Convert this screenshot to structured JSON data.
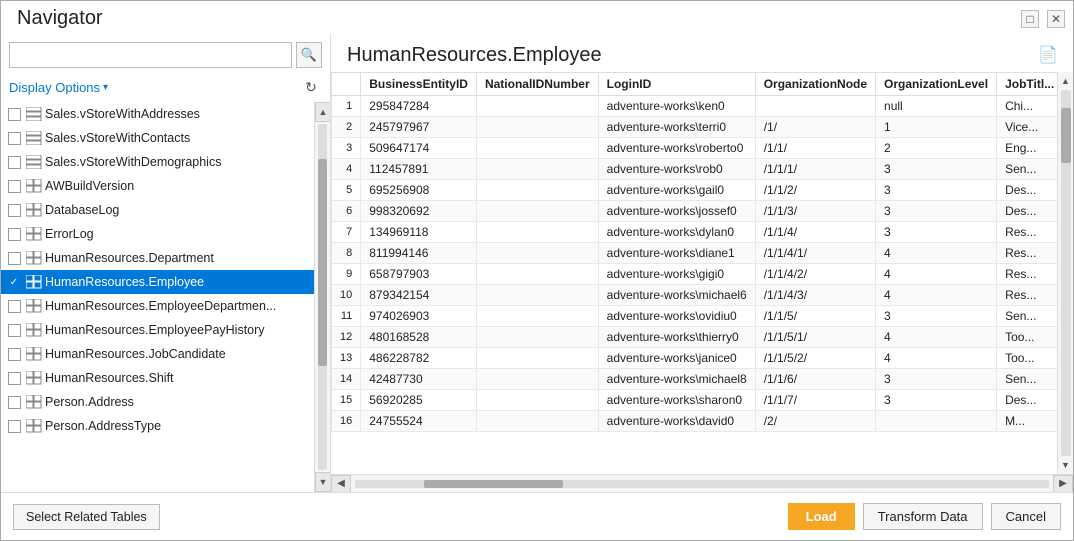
{
  "window": {
    "title": "Navigator"
  },
  "search": {
    "placeholder": "",
    "value": ""
  },
  "display_options": {
    "label": "Display Options",
    "arrow": "▾"
  },
  "nav_items": [
    {
      "id": "salesstorewithaddresses",
      "label": "Sales.vStoreWithAddresses",
      "checked": false,
      "type": "view",
      "selected": false
    },
    {
      "id": "salesstorewithcontacts",
      "label": "Sales.vStoreWithContacts",
      "checked": false,
      "type": "view",
      "selected": false
    },
    {
      "id": "salesstorewithdemographics",
      "label": "Sales.vStoreWithDemographics",
      "checked": false,
      "type": "view",
      "selected": false
    },
    {
      "id": "awbuildversion",
      "label": "AWBuildVersion",
      "checked": false,
      "type": "table",
      "selected": false
    },
    {
      "id": "databaselog",
      "label": "DatabaseLog",
      "checked": false,
      "type": "table",
      "selected": false
    },
    {
      "id": "errorlog",
      "label": "ErrorLog",
      "checked": false,
      "type": "table",
      "selected": false
    },
    {
      "id": "hrdepartment",
      "label": "HumanResources.Department",
      "checked": false,
      "type": "table",
      "selected": false
    },
    {
      "id": "hremployee",
      "label": "HumanResources.Employee",
      "checked": true,
      "type": "table",
      "selected": true
    },
    {
      "id": "hremployeedepartment",
      "label": "HumanResources.EmployeeDepartmen...",
      "checked": false,
      "type": "table",
      "selected": false
    },
    {
      "id": "hremployeepayhistory",
      "label": "HumanResources.EmployeePayHistory",
      "checked": false,
      "type": "table",
      "selected": false
    },
    {
      "id": "hrjobcandidate",
      "label": "HumanResources.JobCandidate",
      "checked": false,
      "type": "table",
      "selected": false
    },
    {
      "id": "hrshift",
      "label": "HumanResources.Shift",
      "checked": false,
      "type": "table",
      "selected": false
    },
    {
      "id": "personaddress",
      "label": "Person.Address",
      "checked": false,
      "type": "table",
      "selected": false
    },
    {
      "id": "personaddresstype",
      "label": "Person.AddressType",
      "checked": false,
      "type": "table",
      "selected": false
    }
  ],
  "preview": {
    "title": "HumanResources.Employee",
    "columns": [
      "BusinessEntityID",
      "NationalIDNumber",
      "LoginID",
      "OrganizationNode",
      "OrganizationLevel",
      "JobTitl..."
    ],
    "rows": [
      {
        "row": 1,
        "BusinessEntityID": "295847284",
        "NationalIDNumber": "",
        "LoginID": "adventure-works\\ken0",
        "OrganizationNode": "",
        "OrganizationLevel": "null",
        "JobTitle": "Chi..."
      },
      {
        "row": 1,
        "col1": "295847284",
        "col2": "",
        "col3": "adventure-works\\ken0",
        "col4": "",
        "col5": "null",
        "col6": "Chi..."
      },
      {
        "row": 2,
        "col1": "245797967",
        "col2": "",
        "col3": "adventure-works\\terri0",
        "col4": "/1/",
        "col5": "1",
        "col6": "Vice..."
      },
      {
        "row": 3,
        "col1": "509647174",
        "col2": "",
        "col3": "adventure-works\\roberto0",
        "col4": "/1/1/",
        "col5": "2",
        "col6": "Eng..."
      },
      {
        "row": 4,
        "col1": "112457891",
        "col2": "",
        "col3": "adventure-works\\rob0",
        "col4": "/1/1/1/",
        "col5": "3",
        "col6": "Sen..."
      },
      {
        "row": 5,
        "col1": "695256908",
        "col2": "",
        "col3": "adventure-works\\gail0",
        "col4": "/1/1/2/",
        "col5": "3",
        "col6": "Des..."
      },
      {
        "row": 6,
        "col1": "998320692",
        "col2": "",
        "col3": "adventure-works\\jossef0",
        "col4": "/1/1/3/",
        "col5": "3",
        "col6": "Des..."
      },
      {
        "row": 7,
        "col1": "134969118",
        "col2": "",
        "col3": "adventure-works\\dylan0",
        "col4": "/1/1/4/",
        "col5": "3",
        "col6": "Res..."
      },
      {
        "row": 8,
        "col1": "811994146",
        "col2": "",
        "col3": "adventure-works\\diane1",
        "col4": "/1/1/4/1/",
        "col5": "4",
        "col6": "Res..."
      },
      {
        "row": 9,
        "col1": "658797903",
        "col2": "",
        "col3": "adventure-works\\gigi0",
        "col4": "/1/1/4/2/",
        "col5": "4",
        "col6": "Res..."
      },
      {
        "row": 10,
        "col1": "879342154",
        "col2": "",
        "col3": "adventure-works\\michael6",
        "col4": "/1/1/4/3/",
        "col5": "4",
        "col6": "Res..."
      },
      {
        "row": 11,
        "col1": "974026903",
        "col2": "",
        "col3": "adventure-works\\ovidiu0",
        "col4": "/1/1/5/",
        "col5": "3",
        "col6": "Sen..."
      },
      {
        "row": 12,
        "col1": "480168528",
        "col2": "",
        "col3": "adventure-works\\thierry0",
        "col4": "/1/1/5/1/",
        "col5": "4",
        "col6": "Too..."
      },
      {
        "row": 13,
        "col1": "486228782",
        "col2": "",
        "col3": "adventure-works\\janice0",
        "col4": "/1/1/5/2/",
        "col5": "4",
        "col6": "Too..."
      },
      {
        "row": 14,
        "col1": "42487730",
        "col2": "",
        "col3": "adventure-works\\michael8",
        "col4": "/1/1/6/",
        "col5": "3",
        "col6": "Sen..."
      },
      {
        "row": 15,
        "col1": "56920285",
        "col2": "",
        "col3": "adventure-works\\sharon0",
        "col4": "/1/1/7/",
        "col5": "3",
        "col6": "Des..."
      },
      {
        "row": 16,
        "col1": "24755524",
        "col2": "",
        "col3": "adventure-works\\david0",
        "col4": "/2/",
        "col5": "",
        "col6": "M..."
      }
    ]
  },
  "footer": {
    "select_related": "Select Related Tables",
    "load": "Load",
    "transform": "Transform Data",
    "cancel": "Cancel"
  },
  "icons": {
    "search": "🔍",
    "refresh": "↻",
    "table": "▦",
    "view": "▤",
    "check": "✓",
    "preview_doc": "📄",
    "scroll_up": "▲",
    "scroll_down": "▼",
    "scroll_left": "◀",
    "scroll_right": "▶"
  }
}
